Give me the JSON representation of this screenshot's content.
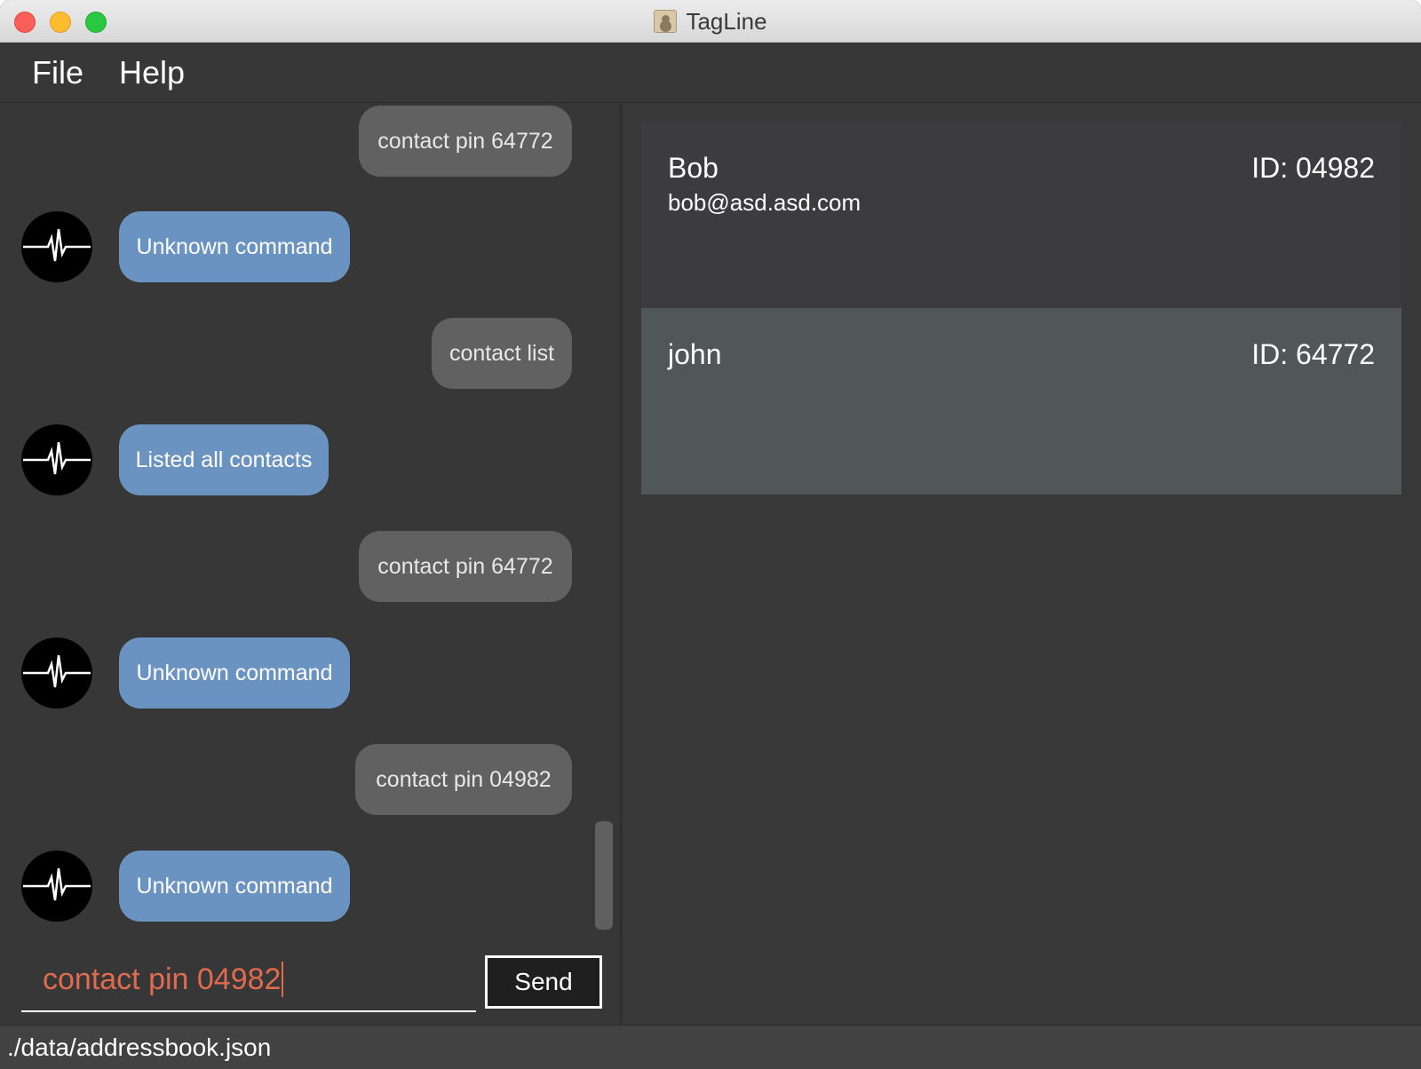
{
  "window": {
    "title": "TagLine",
    "app_icon": "contacts-book-icon"
  },
  "menu": {
    "items": [
      "File",
      "Help"
    ]
  },
  "chat": {
    "messages": [
      {
        "sender": "user",
        "text": "contact pin 64772"
      },
      {
        "sender": "bot",
        "text": "Unknown command"
      },
      {
        "sender": "user",
        "text": "contact list"
      },
      {
        "sender": "bot",
        "text": "Listed all contacts"
      },
      {
        "sender": "user",
        "text": "contact pin 64772"
      },
      {
        "sender": "bot",
        "text": "Unknown command"
      },
      {
        "sender": "user",
        "text": "contact pin 04982"
      },
      {
        "sender": "bot",
        "text": "Unknown command"
      }
    ],
    "bot_avatar_icon": "heartbeat-icon",
    "input_value": "contact pin 04982",
    "send_label": "Send"
  },
  "contacts": [
    {
      "name": "Bob",
      "email": "bob@asd.asd.com",
      "id": "ID: 04982"
    },
    {
      "name": "john",
      "email": "",
      "id": "ID: 64772"
    }
  ],
  "status": {
    "file_path": "./data/addressbook.json"
  },
  "colors": {
    "bot_bubble": "#6b93c2",
    "user_bubble": "#616161",
    "input_text": "#e06b4e",
    "background": "#373737"
  }
}
